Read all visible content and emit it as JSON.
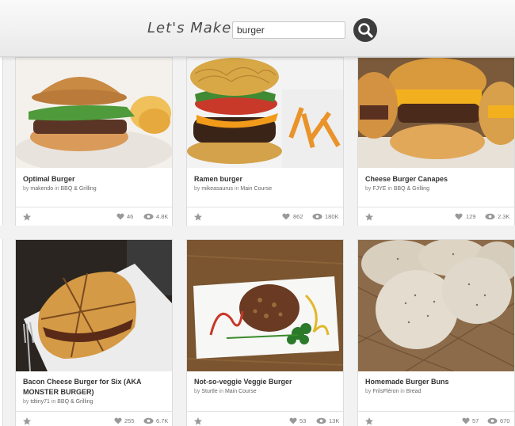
{
  "header": {
    "brand": "Let's Make",
    "search_value": "burger",
    "search_icon": "search-icon"
  },
  "cards": [
    {
      "title": "Optimal Burger",
      "by": "by",
      "author": "makendo",
      "in": "in",
      "category": "BBQ & Grilling",
      "likes": "46",
      "views": "4.8K"
    },
    {
      "title": "Ramen burger",
      "by": "by",
      "author": "mikeasaurus",
      "in": "in",
      "category": "Main Course",
      "likes": "862",
      "views": "180K"
    },
    {
      "title": "Cheese Burger Canapes",
      "by": "by",
      "author": "FJYE",
      "in": "in",
      "category": "BBQ & Grilling",
      "likes": "129",
      "views": "2.3K"
    },
    {
      "title": "Bacon Cheese Burger for Six (AKA MONSTER BURGER)",
      "by": "by",
      "author": "tdtiny71",
      "in": "in",
      "category": "BBQ & Grilling",
      "likes": "255",
      "views": "6.7K"
    },
    {
      "title": "Not-so-veggie Veggie Burger",
      "by": "by",
      "author": "Sturtle",
      "in": "in",
      "category": "Main Course",
      "likes": "53",
      "views": "13K"
    },
    {
      "title": "Homemade Burger Buns",
      "by": "by",
      "author": "FrilsFléron",
      "in": "in",
      "category": "Bread",
      "likes": "57",
      "views": "670"
    }
  ],
  "icons": {
    "favorite": "star-icon",
    "likes": "heart-icon",
    "views": "eye-icon",
    "badge": "trophy-badge-icon"
  }
}
